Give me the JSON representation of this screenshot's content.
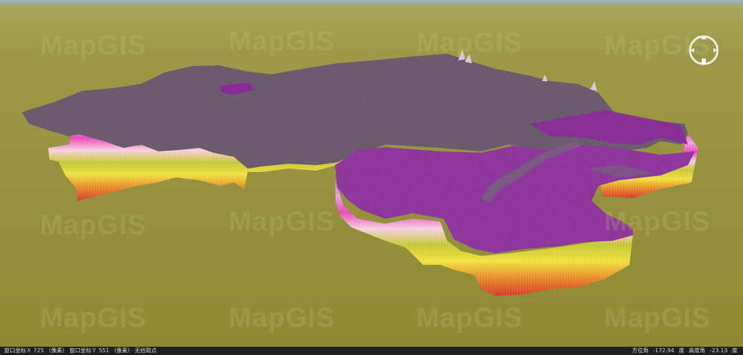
{
  "watermark": {
    "text": "MapGIS"
  },
  "colors": {
    "sky": "#9fb6c8",
    "ground_far": "#9c9a48",
    "ground_near": "#8c8a32",
    "region_top": "#5c4a60",
    "region_top_highlight": "#6e5c72",
    "region_purple": "#8a2a9a",
    "strata": [
      "#d86ad0",
      "#f0a0e8",
      "#e84ab8",
      "#f6d0e0",
      "#c8c838",
      "#f0e040",
      "#e8902c",
      "#d83a2a"
    ]
  },
  "compass": {
    "icon": "compass-icon"
  },
  "status": {
    "window_x_label": "窗口坐标Ｘ",
    "window_x_value": "725",
    "window_x_unit": "（像素）",
    "window_y_label": "窗口坐标Ｙ",
    "window_y_value": "551",
    "window_y_unit": "（像素）",
    "pick_state": "无拾取点",
    "azimuth_label": "方位角",
    "azimuth_value": "-172.94",
    "azimuth_unit": "度",
    "elevation_label": "高度角",
    "elevation_value": "-23.13",
    "elevation_unit": "度"
  }
}
